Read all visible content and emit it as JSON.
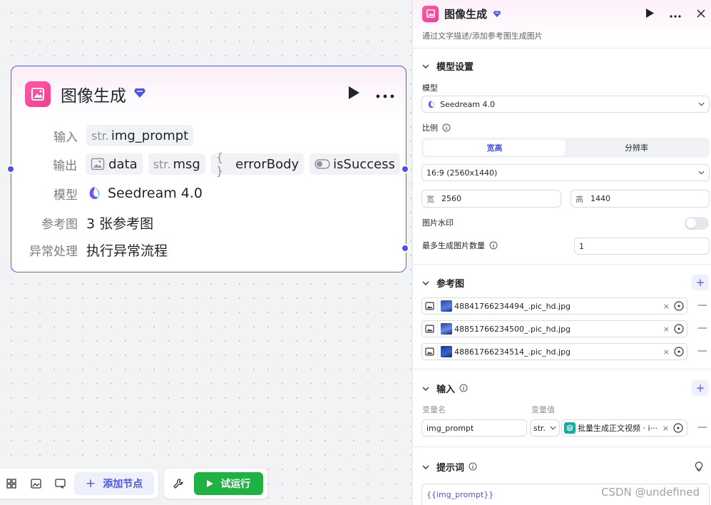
{
  "node": {
    "title": "图像生成",
    "rows": {
      "input_label": "输入",
      "input_pills": [
        {
          "prefix": "str.",
          "name": "img_prompt"
        }
      ],
      "output_label": "输出",
      "output_pills": [
        {
          "prefix": "",
          "name": "data",
          "icon": "image-icon"
        },
        {
          "prefix": "str.",
          "name": "msg"
        },
        {
          "prefix": "{ }",
          "name": "errorBody"
        },
        {
          "prefix": "",
          "name": "isSuccess",
          "icon": "toggle-icon"
        }
      ],
      "model_label": "模型",
      "model_value": "Seedream 4.0",
      "ref_label": "参考图",
      "ref_value": "3 张参考图",
      "error_label": "异常处理",
      "error_value": "执行异常流程"
    }
  },
  "toolbar": {
    "add_node_label": "添加节点",
    "run_label": "试运行"
  },
  "panel": {
    "title": "图像生成",
    "subtitle": "通过文字描述/添加参考图生成图片",
    "model_section": {
      "title": "模型设置",
      "model_label": "模型",
      "model_value": "Seedream 4.0",
      "ratio_label": "比例",
      "seg_options": [
        "宽高",
        "分辨率"
      ],
      "ratio_value": "16:9 (2560x1440)",
      "width_label": "宽",
      "width_value": "2560",
      "height_label": "高",
      "height_value": "1440",
      "watermark_label": "图片水印",
      "max_count_label": "最多生成图片数量",
      "max_count_value": "1"
    },
    "ref_section": {
      "title": "参考图",
      "files": [
        "48841766234494_.pic_hd.jpg",
        "48851766234500_.pic_hd.jpg",
        "48861766234514_.pic_hd.jpg"
      ]
    },
    "input_section": {
      "title": "输入",
      "col_name": "变量名",
      "col_value": "变量值",
      "var_name": "img_prompt",
      "var_type": "str.",
      "var_value": "批量生成正文视频 · i···"
    },
    "prompt_section": {
      "title": "提示词",
      "value": "{{img_prompt}}"
    }
  },
  "watermark_text": "CSDN @undefined",
  "colors": {
    "accent": "#4d53e8",
    "pink": "#f33d8f",
    "run_green": "#1fb141"
  }
}
